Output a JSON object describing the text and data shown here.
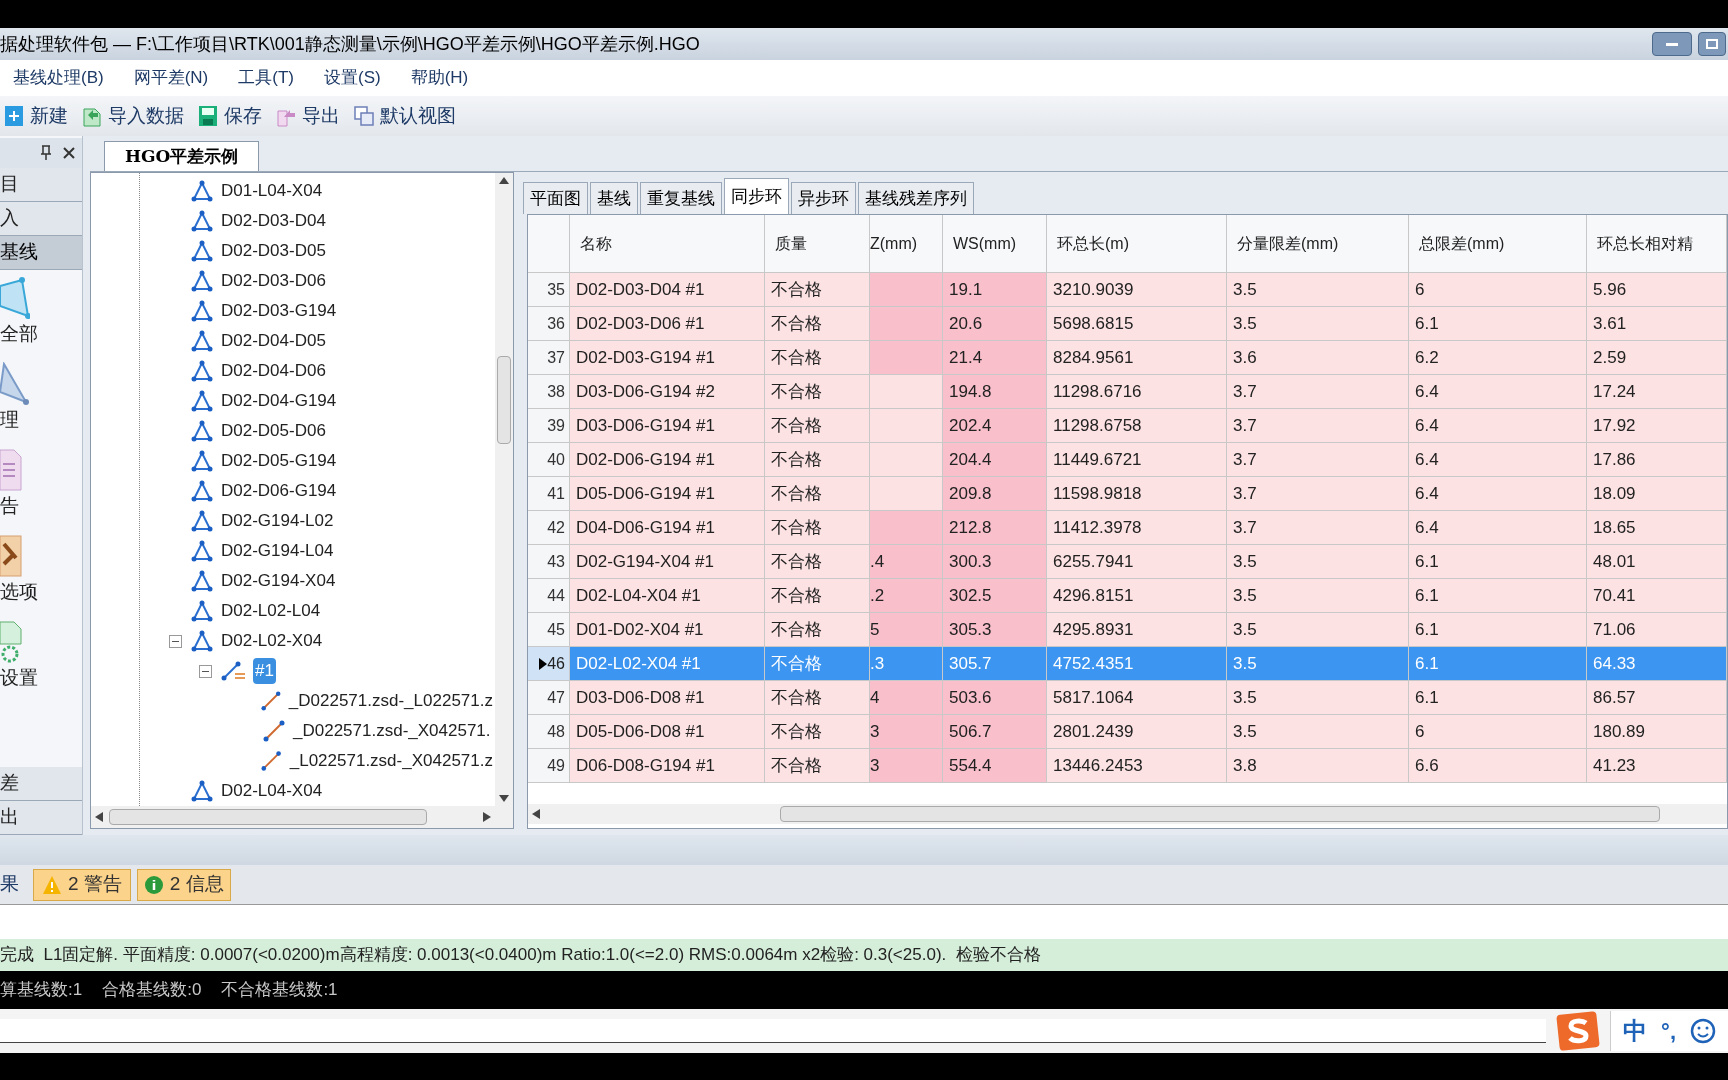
{
  "window": {
    "title": "据处理软件包 — F:\\工作项目\\RTK\\001静态测量\\示例\\HGO平差示例\\HGO平差示例.HGO"
  },
  "menu": [
    "基线处理(B)",
    "网平差(N)",
    "工具(T)",
    "设置(S)",
    "帮助(H)"
  ],
  "toolbar": [
    {
      "label": "新建",
      "kind": "new"
    },
    {
      "label": "导入数据",
      "kind": "import"
    },
    {
      "label": "保存",
      "kind": "save"
    },
    {
      "label": "导出",
      "kind": "export"
    },
    {
      "label": "默认视图",
      "kind": "view"
    }
  ],
  "side_panel": {
    "items": [
      {
        "label": "目",
        "kind": "section",
        "selected": false
      },
      {
        "label": "入",
        "kind": "section",
        "selected": false
      },
      {
        "label": "基线",
        "kind": "section",
        "selected": true
      },
      {
        "label": "全部",
        "kind": "network",
        "selected": false
      },
      {
        "label": "理",
        "kind": "triangle",
        "selected": false
      },
      {
        "label": "告",
        "kind": "report",
        "selected": false
      },
      {
        "label": "选项",
        "kind": "tools",
        "selected": false
      },
      {
        "label": "设置",
        "kind": "settings",
        "selected": false
      },
      {
        "label": "差",
        "kind": "section",
        "selected": false
      },
      {
        "label": "出",
        "kind": "section",
        "selected": false
      }
    ]
  },
  "document_tab": "HGO平差示例",
  "tree": [
    {
      "label": "D01-L04-X04",
      "kind": "loop",
      "selected": false
    },
    {
      "label": "D02-D03-D04",
      "kind": "loop",
      "selected": false
    },
    {
      "label": "D02-D03-D05",
      "kind": "loop",
      "selected": false
    },
    {
      "label": "D02-D03-D06",
      "kind": "loop",
      "selected": false
    },
    {
      "label": "D02-D03-G194",
      "kind": "loop",
      "selected": false
    },
    {
      "label": "D02-D04-D05",
      "kind": "loop",
      "selected": false
    },
    {
      "label": "D02-D04-D06",
      "kind": "loop",
      "selected": false
    },
    {
      "label": "D02-D04-G194",
      "kind": "loop",
      "selected": false
    },
    {
      "label": "D02-D05-D06",
      "kind": "loop",
      "selected": false
    },
    {
      "label": "D02-D05-G194",
      "kind": "loop",
      "selected": false
    },
    {
      "label": "D02-D06-G194",
      "kind": "loop",
      "selected": false
    },
    {
      "label": "D02-G194-L02",
      "kind": "loop",
      "selected": false
    },
    {
      "label": "D02-G194-L04",
      "kind": "loop",
      "selected": false
    },
    {
      "label": "D02-G194-X04",
      "kind": "loop",
      "selected": false
    },
    {
      "label": "D02-L02-L04",
      "kind": "loop",
      "selected": false
    },
    {
      "label": "D02-L02-X04",
      "kind": "loop",
      "selected": false,
      "expanded": true,
      "children": [
        {
          "label": "#1",
          "kind": "group",
          "selected": true,
          "expanded": true,
          "children": [
            {
              "label": "_D022571.zsd-_L022571.z",
              "kind": "baseline",
              "selected": false
            },
            {
              "label": "_D022571.zsd-_X042571.",
              "kind": "baseline",
              "selected": false
            },
            {
              "label": "_L022571.zsd-_X042571.z",
              "kind": "baseline",
              "selected": false
            }
          ]
        }
      ]
    },
    {
      "label": "D02-L04-X04",
      "kind": "loop",
      "selected": false
    }
  ],
  "tabs": [
    {
      "label": "平面图",
      "selected": false
    },
    {
      "label": "基线",
      "selected": false
    },
    {
      "label": "重复基线",
      "selected": false
    },
    {
      "label": "同步环",
      "selected": true
    },
    {
      "label": "异步环",
      "selected": false
    },
    {
      "label": "基线残差序列",
      "selected": false
    }
  ],
  "table": {
    "columns": [
      "名称",
      "质量",
      "Z(mm)",
      "WS(mm)",
      "环总长(m)",
      "分量限差(mm)",
      "总限差(mm)",
      "环总长相对精"
    ],
    "rows": [
      {
        "index": "35",
        "selected": false,
        "z_flag": true,
        "cells": [
          "D02-D03-D04 #1",
          "不合格",
          "",
          "19.1",
          "3210.9039",
          "3.5",
          "6",
          "5.96"
        ]
      },
      {
        "index": "36",
        "selected": false,
        "z_flag": true,
        "cells": [
          "D02-D03-D06 #1",
          "不合格",
          "",
          "20.6",
          "5698.6815",
          "3.5",
          "6.1",
          "3.61"
        ]
      },
      {
        "index": "37",
        "selected": false,
        "z_flag": true,
        "cells": [
          "D02-D03-G194 #1",
          "不合格",
          "",
          "21.4",
          "8284.9561",
          "3.6",
          "6.2",
          "2.59"
        ]
      },
      {
        "index": "38",
        "selected": false,
        "z_flag": false,
        "cells": [
          "D03-D06-G194 #2",
          "不合格",
          "",
          "194.8",
          "11298.6716",
          "3.7",
          "6.4",
          "17.24"
        ]
      },
      {
        "index": "39",
        "selected": false,
        "z_flag": false,
        "cells": [
          "D03-D06-G194 #1",
          "不合格",
          "",
          "202.4",
          "11298.6758",
          "3.7",
          "6.4",
          "17.92"
        ]
      },
      {
        "index": "40",
        "selected": false,
        "z_flag": false,
        "cells": [
          "D02-D06-G194 #1",
          "不合格",
          "",
          "204.4",
          "11449.6721",
          "3.7",
          "6.4",
          "17.86"
        ]
      },
      {
        "index": "41",
        "selected": false,
        "z_flag": false,
        "cells": [
          "D05-D06-G194 #1",
          "不合格",
          "",
          "209.8",
          "11598.9818",
          "3.7",
          "6.4",
          "18.09"
        ]
      },
      {
        "index": "42",
        "selected": false,
        "z_flag": true,
        "cells": [
          "D04-D06-G194 #1",
          "不合格",
          "",
          "212.8",
          "11412.3978",
          "3.7",
          "6.4",
          "18.65"
        ]
      },
      {
        "index": "43",
        "selected": false,
        "z_flag": true,
        "cells": [
          "D02-G194-X04 #1",
          "不合格",
          ".4",
          "300.3",
          "6255.7941",
          "3.5",
          "6.1",
          "48.01"
        ]
      },
      {
        "index": "44",
        "selected": false,
        "z_flag": true,
        "cells": [
          "D02-L04-X04 #1",
          "不合格",
          ".2",
          "302.5",
          "4296.8151",
          "3.5",
          "6.1",
          "70.41"
        ]
      },
      {
        "index": "45",
        "selected": false,
        "z_flag": true,
        "cells": [
          "D01-D02-X04 #1",
          "不合格",
          "5",
          "305.3",
          "4295.8931",
          "3.5",
          "6.1",
          "71.06"
        ]
      },
      {
        "index": "46",
        "selected": true,
        "cells": [
          "D02-L02-X04 #1",
          "不合格",
          ".3",
          "305.7",
          "4752.4351",
          "3.5",
          "6.1",
          "64.33"
        ]
      },
      {
        "index": "47",
        "selected": false,
        "z_flag": true,
        "cells": [
          "D03-D06-D08 #1",
          "不合格",
          "4",
          "503.6",
          "5817.1064",
          "3.5",
          "6.1",
          "86.57"
        ]
      },
      {
        "index": "48",
        "selected": false,
        "z_flag": true,
        "cells": [
          "D05-D06-D08 #1",
          "不合格",
          "3",
          "506.7",
          "2801.2439",
          "3.5",
          "6",
          "180.89"
        ]
      },
      {
        "index": "49",
        "selected": false,
        "z_flag": true,
        "cells": [
          "D06-D08-G194 #1",
          "不合格",
          "3",
          "554.4",
          "13446.2453",
          "3.8",
          "6.6",
          "41.23"
        ]
      }
    ]
  },
  "output_tabs": [
    {
      "label": "果",
      "kind": "plain",
      "selected": false
    },
    {
      "label": "2 警告",
      "kind": "warning",
      "selected": true
    },
    {
      "label": "2 信息",
      "kind": "info",
      "selected": true
    }
  ],
  "status_message": "完成  L1固定解. 平面精度: 0.0007(<0.0200)m高程精度: 0.0013(<0.0400)m Ratio:1.0(<=2.0) RMS:0.0064m x2检验: 0.3(<25.0).  检验不合格",
  "summary": [
    "算基线数:1",
    "合格基线数:0",
    "不合格基线数:1"
  ],
  "ime": {
    "language": "中",
    "punctuation": "°,"
  }
}
